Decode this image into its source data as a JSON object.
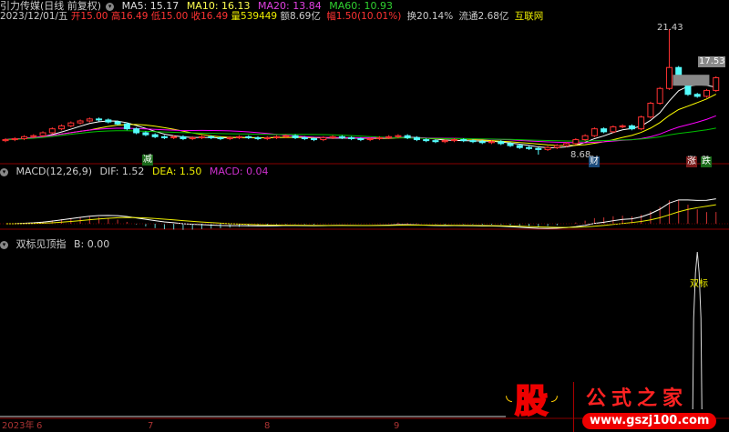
{
  "header": {
    "title": "引力传媒(日线 前复权)",
    "ma5": "MA5: 15.17",
    "ma10": "MA10: 16.13",
    "ma20": "MA20: 13.84",
    "ma60": "MA60: 10.93"
  },
  "quote": {
    "date": "2023/12/01/五",
    "open": "开15.00",
    "high": "高16.49",
    "low": "低15.00",
    "close": "收16.49",
    "volume": "量539449",
    "amount": "额8.69亿",
    "change": "幅1.50(10.01%)",
    "turnover": "换20.14%",
    "float": "流通2.68亿",
    "sector": "互联网"
  },
  "macd": {
    "label": "MACD(12,26,9)",
    "dif": "DIF: 1.52",
    "dea": "DEA: 1.50",
    "macd": "MACD: 0.04"
  },
  "indicator": {
    "label": "双标见顶指",
    "b": "B: 0.00",
    "mark": "双标"
  },
  "markers": {
    "high": "21.43",
    "low": "8.68",
    "last": "17.53",
    "jian": "减",
    "cai": "财",
    "zhang": "涨",
    "die": "跌"
  },
  "axis": {
    "year": "2023年",
    "months": [
      "6",
      "7",
      "8",
      "9"
    ]
  },
  "logo": {
    "brand": "股",
    "name": "公式之家",
    "url": "www.gszj100.com"
  },
  "colors": {
    "up": "#ff3232",
    "down": "#54fcfc",
    "ma5": "#ffffff",
    "ma10": "#ffff00",
    "ma20": "#ff00ff",
    "ma60": "#00c000"
  },
  "chart_data": {
    "type": "candlestick",
    "closes": [
      10.2,
      10.3,
      10.5,
      10.6,
      10.9,
      11.3,
      11.6,
      11.9,
      12.1,
      12.3,
      12.2,
      12.0,
      11.8,
      11.3,
      10.9,
      10.7,
      10.5,
      10.4,
      10.5,
      10.3,
      10.4,
      10.5,
      10.4,
      10.3,
      10.4,
      10.5,
      10.4,
      10.3,
      10.4,
      10.5,
      10.6,
      10.4,
      10.3,
      10.2,
      10.4,
      10.5,
      10.4,
      10.3,
      10.2,
      10.3,
      10.4,
      10.5,
      10.6,
      10.4,
      10.2,
      10.1,
      10.0,
      10.1,
      10.2,
      10.1,
      10.0,
      9.9,
      10.0,
      9.8,
      9.6,
      9.4,
      9.3,
      9.2,
      9.4,
      9.6,
      9.8,
      10.2,
      10.6,
      11.3,
      11.0,
      11.5,
      11.6,
      11.3,
      12.5,
      13.9,
      15.4,
      17.53,
      16.5,
      14.8,
      14.6,
      15.2,
      16.49
    ],
    "high_price": 21.43,
    "high_index": 71,
    "low_price": 8.68,
    "low_index": 57,
    "signal_index": 74
  }
}
